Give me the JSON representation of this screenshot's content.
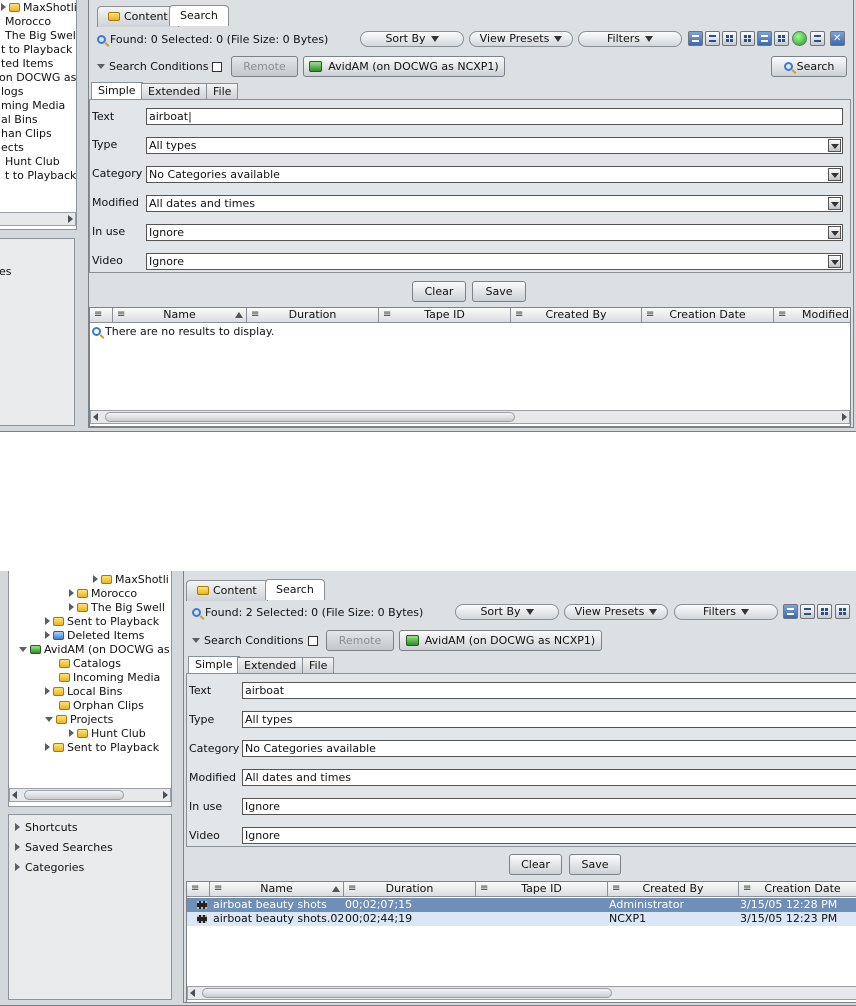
{
  "shot_a": {
    "tree": [
      "MaxShotli",
      "Morocco",
      "The Big Swell",
      "t to Playback",
      "ted Items",
      "on DOCWG as N",
      "logs",
      "ming Media",
      "al Bins",
      "han Clips",
      "ects",
      "Hunt Club",
      "t to Playback"
    ],
    "side_fragment": "es",
    "tabs": {
      "content": "Content",
      "search": "Search"
    },
    "status": "Found: 0 Selected: 0 (File Size: 0 Bytes)",
    "sort_by": "Sort By",
    "view_presets": "View Presets",
    "filters": "Filters",
    "search_conditions": "Search Conditions",
    "remote": "Remote",
    "server": "AvidAM (on DOCWG as NCXP1)",
    "search_button": "Search",
    "subtabs": [
      "Simple",
      "Extended",
      "File"
    ],
    "fields": [
      {
        "label": "Text",
        "value": "airboat|"
      },
      {
        "label": "Type",
        "value": "All types"
      },
      {
        "label": "Category",
        "value": "No Categories available"
      },
      {
        "label": "Modified",
        "value": "All dates and times"
      },
      {
        "label": "In use",
        "value": "Ignore"
      },
      {
        "label": "Video",
        "value": "Ignore"
      }
    ],
    "clear": "Clear",
    "save": "Save",
    "columns": [
      "Name",
      "Duration",
      "Tape ID",
      "Created By",
      "Creation Date",
      "Modified"
    ],
    "no_results": "There are no results to display."
  },
  "shot_b": {
    "tree": [
      "MaxShotli",
      "Morocco",
      "The Big Swell",
      "Sent to Playback",
      "Deleted Items",
      "AvidAM (on DOCWG as N",
      "Catalogs",
      "Incoming Media",
      "Local Bins",
      "Orphan Clips",
      "Projects",
      "Hunt Club",
      "Sent to Playback"
    ],
    "side_items": [
      "Shortcuts",
      "Saved Searches",
      "Categories"
    ],
    "tabs": {
      "content": "Content",
      "search": "Search"
    },
    "status": "Found: 2 Selected: 0 (File Size: 0 Bytes)",
    "sort_by": "Sort By",
    "view_presets": "View Presets",
    "filters": "Filters",
    "search_conditions": "Search Conditions",
    "remote": "Remote",
    "server": "AvidAM (on DOCWG as NCXP1)",
    "subtabs": [
      "Simple",
      "Extended",
      "File"
    ],
    "fields": [
      {
        "label": "Text",
        "value": "airboat"
      },
      {
        "label": "Type",
        "value": "All types"
      },
      {
        "label": "Category",
        "value": "No Categories available"
      },
      {
        "label": "Modified",
        "value": "All dates and times"
      },
      {
        "label": "In use",
        "value": "Ignore"
      },
      {
        "label": "Video",
        "value": "Ignore"
      }
    ],
    "clear": "Clear",
    "save": "Save",
    "columns": [
      "Name",
      "Duration",
      "Tape ID",
      "Created By",
      "Creation Date"
    ],
    "rows": [
      {
        "name": "airboat beauty shots",
        "duration": "00;02;07;15",
        "tape_id": "",
        "created_by": "Administrator",
        "creation_date": "3/15/05 12:28 PM"
      },
      {
        "name": "airboat beauty shots.02",
        "duration": "00;02;44;19",
        "tape_id": "",
        "created_by": "NCXP1",
        "creation_date": "3/15/05 12:23 PM"
      }
    ]
  },
  "colors": {
    "selected_row": "#6f8fb8",
    "alt_row": "#dbe7f6",
    "panel": "#dde0e3"
  }
}
